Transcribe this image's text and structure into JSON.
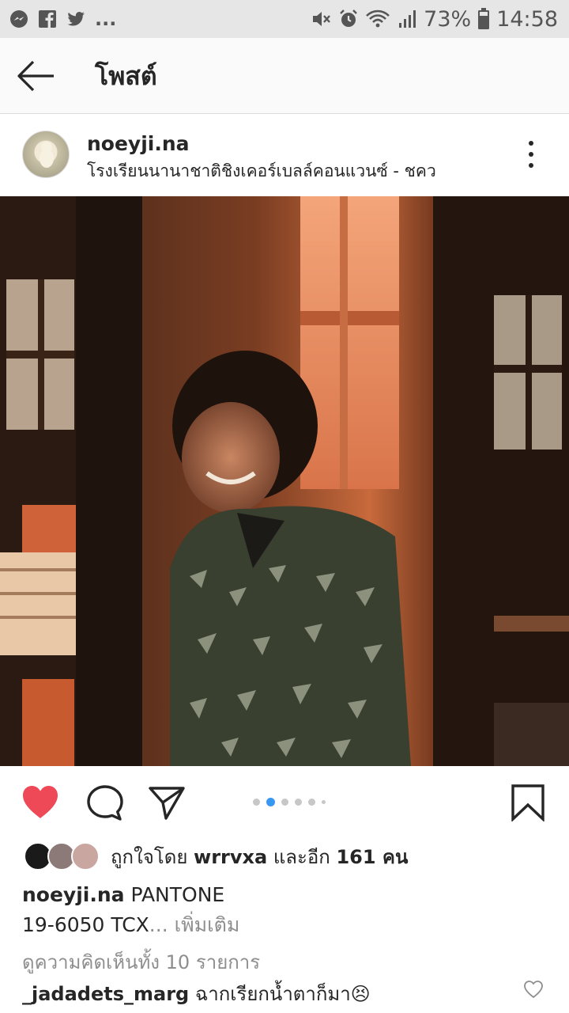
{
  "status_bar": {
    "battery_percent": "73%",
    "time": "14:58",
    "more": "...",
    "left_icons": [
      "messenger-icon",
      "facebook-icon",
      "twitter-icon"
    ],
    "right_icons": [
      "mute-icon",
      "alarm-icon",
      "wifi-icon",
      "signal-icon",
      "battery-icon"
    ]
  },
  "header": {
    "title": "โพสต์",
    "back_icon": "back-arrow-icon"
  },
  "post": {
    "username": "noeyji.na",
    "location": "โรงเรียนนานาชาติชิงเคอร์เบลล์คอนแวนซ์ - ชคว",
    "likes_prefix": "ถูกใจโดย ",
    "liked_by": "wrrvxa",
    "likes_suffix_and": " และอีก ",
    "likes_count": "161 คน",
    "caption_user": "noeyji.na",
    "caption_text_line1": " PANTONE",
    "caption_text_line2": "19-6050 TCX",
    "caption_ellipsis": "... ",
    "caption_more": "เพิ่มเติม",
    "view_comments": "ดูความคิดเห็นทั้ง 10 รายการ",
    "comment_user": "_jadadets_marg",
    "comment_text": " ฉากเรียกน้ำตาก็มา😣",
    "carousel": {
      "count": 6,
      "active_index": 1
    },
    "liked": true
  },
  "colors": {
    "like_red": "#ed4956",
    "carousel_active": "#3897f0",
    "muted_text": "#8e8e8e",
    "status_bar_bg": "#e6e6e6"
  }
}
